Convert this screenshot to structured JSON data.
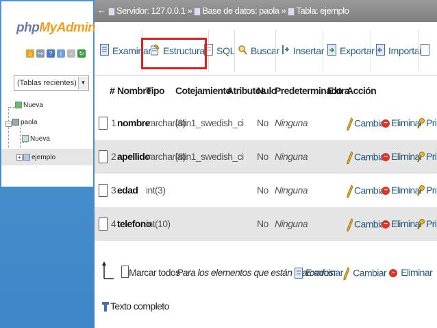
{
  "app": {
    "logo_php": "php",
    "logo_my": "My",
    "logo_admin": "Admin"
  },
  "colors": {
    "link": "#235a81",
    "highlight_box": "#e02020",
    "topbar": "#8c8c8c",
    "row_alt": "#e5e5e5"
  },
  "sidebar": {
    "recent_select": "(Tablas recientes) ...",
    "tree": [
      {
        "label": "Nueva",
        "level": 0
      },
      {
        "label": "paola",
        "level": 0
      },
      {
        "label": "Nueva",
        "level": 1
      },
      {
        "label": "ejemplo",
        "level": 1
      }
    ]
  },
  "breadcrumb": {
    "server": "Servidor: 127.0.0.1",
    "sep1": "»",
    "database": "Base de datos: paola",
    "sep2": "»",
    "table": "Tabla: ejemplo"
  },
  "tabs": [
    {
      "label": "Examinar"
    },
    {
      "label": "Estructura"
    },
    {
      "label": "SQL"
    },
    {
      "label": "Buscar"
    },
    {
      "label": "Insertar"
    },
    {
      "label": "Exportar"
    },
    {
      "label": "Importar"
    }
  ],
  "table": {
    "headers": [
      "#",
      "Nombre",
      "Tipo",
      "Cotejamiento",
      "Atributos",
      "Nulo",
      "Predeterminado",
      "Extra",
      "Acción"
    ],
    "rows": [
      {
        "num": "1",
        "name": "nombre",
        "type": "varchar(8)",
        "collation": "latin1_swedish_ci",
        "null": "No",
        "default": "Ninguna"
      },
      {
        "num": "2",
        "name": "apellido",
        "type": "varchar(8)",
        "collation": "latin1_swedish_ci",
        "null": "No",
        "default": "Ninguna"
      },
      {
        "num": "3",
        "name": "edad",
        "type": "int(3)",
        "collation": "",
        "null": "No",
        "default": "Ninguna"
      },
      {
        "num": "4",
        "name": "telefono",
        "type": "int(10)",
        "collation": "",
        "null": "No",
        "default": "Ninguna"
      }
    ],
    "actions": {
      "change": "Cambiar",
      "delete": "Eliminar",
      "primary": "Pri"
    }
  },
  "bulk": {
    "check_all": "Marcar todos",
    "for_selected": "Para los elementos que están marcados:",
    "browse": "Examinar",
    "change": "Cambiar",
    "delete": "Eliminar"
  },
  "footer": {
    "full_text": "Texto completo"
  }
}
